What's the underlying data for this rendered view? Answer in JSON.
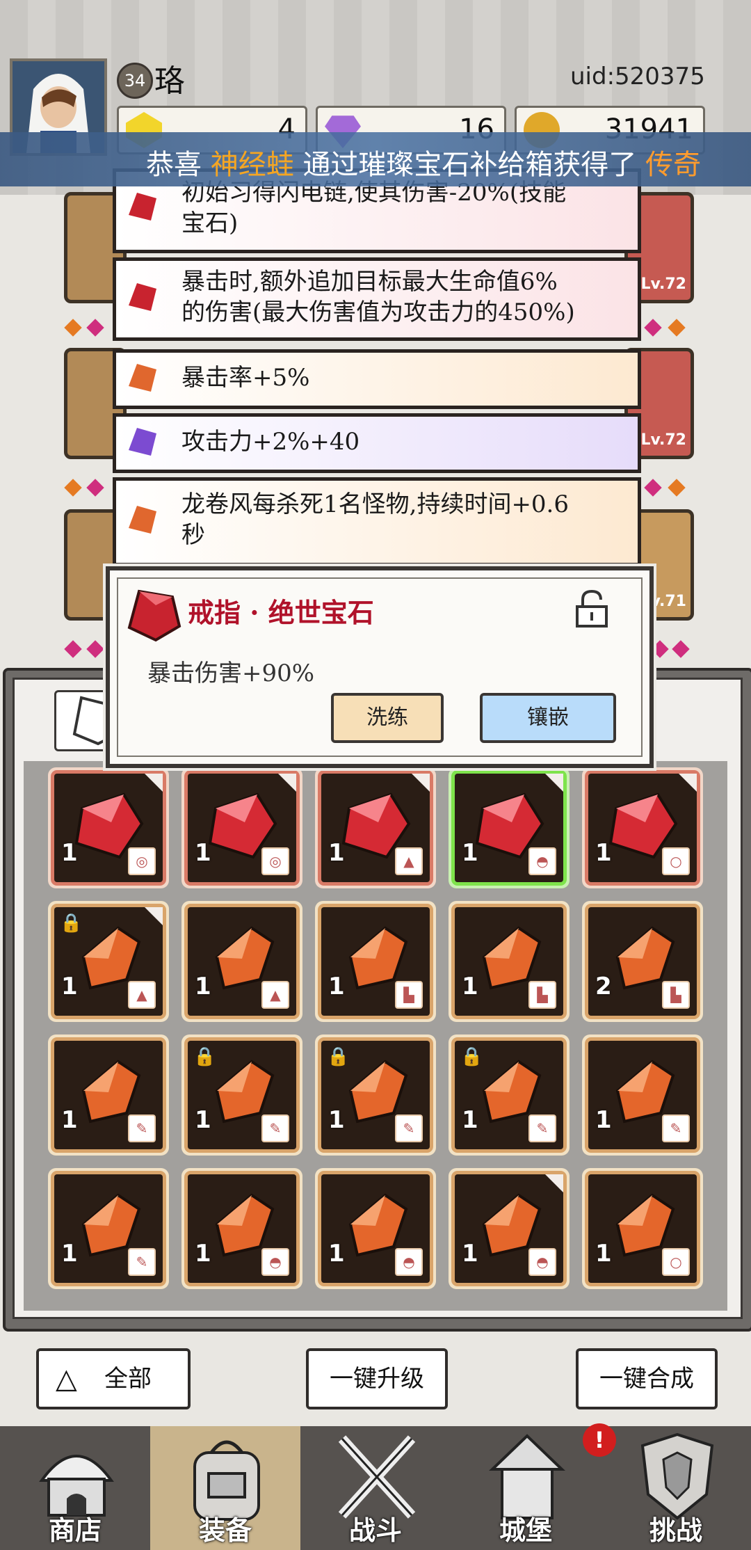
{
  "player": {
    "level": "34",
    "name": "珞",
    "uid": "uid:520375"
  },
  "resources": [
    {
      "icon": "yellow-gem-icon",
      "value": "4",
      "color": "#f2d52b"
    },
    {
      "icon": "purple-diamond-icon",
      "value": "16",
      "color": "#a36ad8"
    },
    {
      "icon": "gold-coin-icon",
      "value": "31941",
      "color": "#e0a82a"
    }
  ],
  "marquee": {
    "prefix": "恭喜",
    "player": "神经蛙",
    "middle": "通过璀璨宝石补给箱获得了",
    "reward": "传奇"
  },
  "side_levels": {
    "r1": "Lv.72",
    "r2": "Lv.72",
    "r3": "Lv.71"
  },
  "stats": [
    {
      "text1": "初始习得闪电链,使其伤害-20%(技能",
      "text2": "宝石)",
      "gem": "red"
    },
    {
      "text1": "暴击时,额外追加目标最大生命值6%",
      "text2": "的伤害(最大伤害值为攻击力的450%)",
      "gem": "red"
    },
    {
      "text1": "暴击率+5%",
      "text2": "",
      "gem": "orange"
    },
    {
      "text1": "攻击力+2%+40",
      "text2": "",
      "gem": "purple"
    },
    {
      "text1": "龙卷风每杀死1名怪物,持续时间+0.6",
      "text2": "秒",
      "gem": "orange"
    }
  ],
  "popup": {
    "title": "戒指 · 绝世宝石",
    "stat": "暴击伤害+90%",
    "reroll_label": "洗练",
    "inlay_label": "镶嵌"
  },
  "inventory": {
    "plus_label": "+",
    "rows": [
      [
        {
          "count": "1",
          "type": "red",
          "tag": "ring"
        },
        {
          "count": "1",
          "type": "red",
          "tag": "ring"
        },
        {
          "count": "1",
          "type": "red",
          "tag": "armor"
        },
        {
          "count": "1",
          "type": "red",
          "tag": "helmet",
          "selected": true
        },
        {
          "count": "1",
          "type": "red",
          "tag": "necklace"
        }
      ],
      [
        {
          "count": "1",
          "type": "orange",
          "tag": "armor",
          "locked": true
        },
        {
          "count": "1",
          "type": "orange",
          "tag": "armor"
        },
        {
          "count": "1",
          "type": "orange",
          "tag": "boots"
        },
        {
          "count": "1",
          "type": "orange",
          "tag": "boots"
        },
        {
          "count": "2",
          "type": "orange",
          "tag": "boots"
        }
      ],
      [
        {
          "count": "1",
          "type": "orange",
          "tag": "weapon"
        },
        {
          "count": "1",
          "type": "orange",
          "tag": "weapon",
          "locked": true
        },
        {
          "count": "1",
          "type": "orange",
          "tag": "weapon",
          "locked": true
        },
        {
          "count": "1",
          "type": "orange",
          "tag": "weapon",
          "locked": true
        },
        {
          "count": "1",
          "type": "orange",
          "tag": "weapon"
        }
      ],
      [
        {
          "count": "1",
          "type": "orange",
          "tag": "weapon"
        },
        {
          "count": "1",
          "type": "orange",
          "tag": "helmet"
        },
        {
          "count": "1",
          "type": "orange",
          "tag": "helmet"
        },
        {
          "count": "1",
          "type": "orange",
          "tag": "helmet"
        },
        {
          "count": "1",
          "type": "orange",
          "tag": "necklace"
        }
      ]
    ]
  },
  "actions": {
    "filter_label": "全部",
    "upgrade_label": "一键升级",
    "merge_label": "一键合成"
  },
  "nav": [
    {
      "label": "商店",
      "icon": "shop-hut-icon"
    },
    {
      "label": "装备",
      "icon": "backpack-icon",
      "active": true
    },
    {
      "label": "战斗",
      "icon": "crossed-swords-icon"
    },
    {
      "label": "城堡",
      "icon": "castle-tower-icon"
    },
    {
      "label": "挑战",
      "icon": "shield-crest-icon"
    }
  ],
  "nav_badge": "!"
}
